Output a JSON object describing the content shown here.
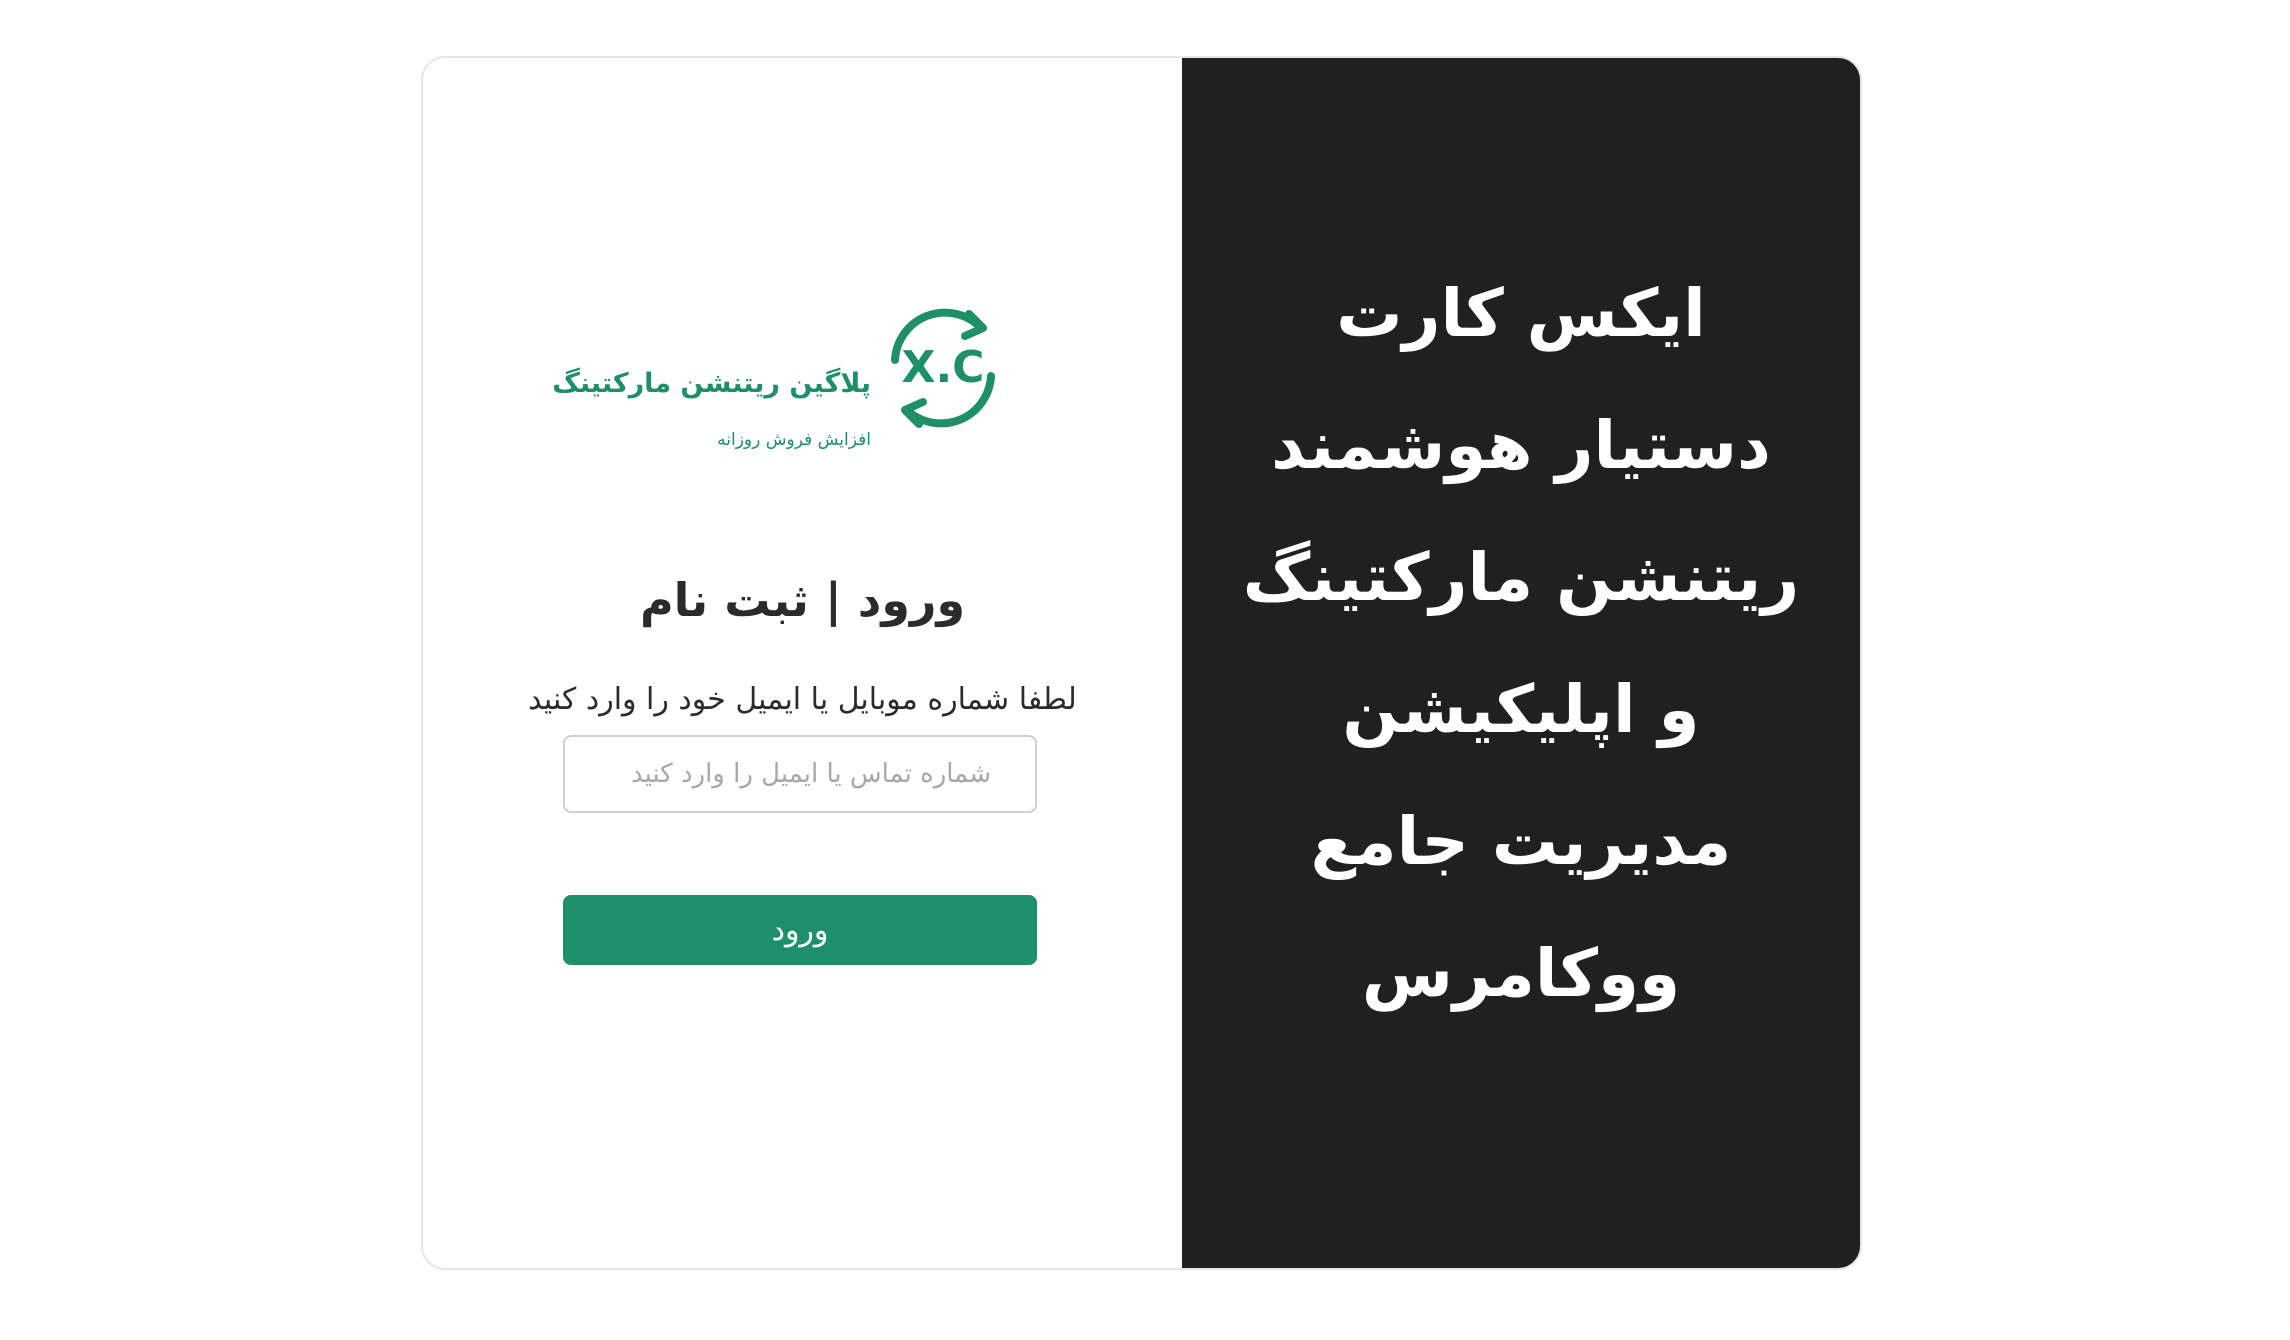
{
  "logo": {
    "mark_text": "X.C",
    "title": "پلاگین ریتنشن مارکتینگ",
    "tagline": "افزایش فروش روزانه",
    "color": "#1f8f67"
  },
  "login": {
    "heading": "ورود | ثبت نام",
    "instruction": "لطفا شماره موبایل یا ایمیل خود را وارد کنید",
    "contact_input": {
      "value": "",
      "placeholder": "شماره تماس یا ایمیل را وارد کنید"
    },
    "submit_label": "ورود",
    "accent_color": "#1e8f6b"
  },
  "promo": {
    "lines": [
      "ایکس کارت",
      "دستیار هوشمند",
      "ریتنشن مارکتینگ",
      "و اپلیکیشن",
      "مدیریت جامع",
      "ووکامرس"
    ],
    "background": "#202020"
  }
}
